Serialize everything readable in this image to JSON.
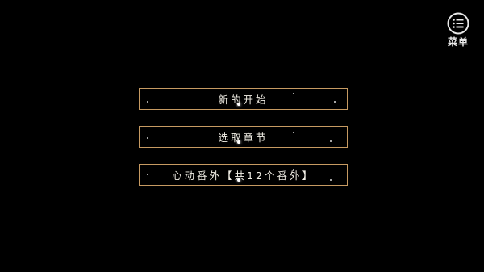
{
  "header": {
    "menu_label": "菜单",
    "menu_icon": "list-menu-icon"
  },
  "options": [
    {
      "label": "新的开始"
    },
    {
      "label": "选取章节"
    },
    {
      "label": "心动番外【共12个番外】"
    }
  ],
  "colors": {
    "background": "#000000",
    "option_border": "#c69a62",
    "option_text": "#f2efe6",
    "menu_text": "#e8e8e8"
  }
}
